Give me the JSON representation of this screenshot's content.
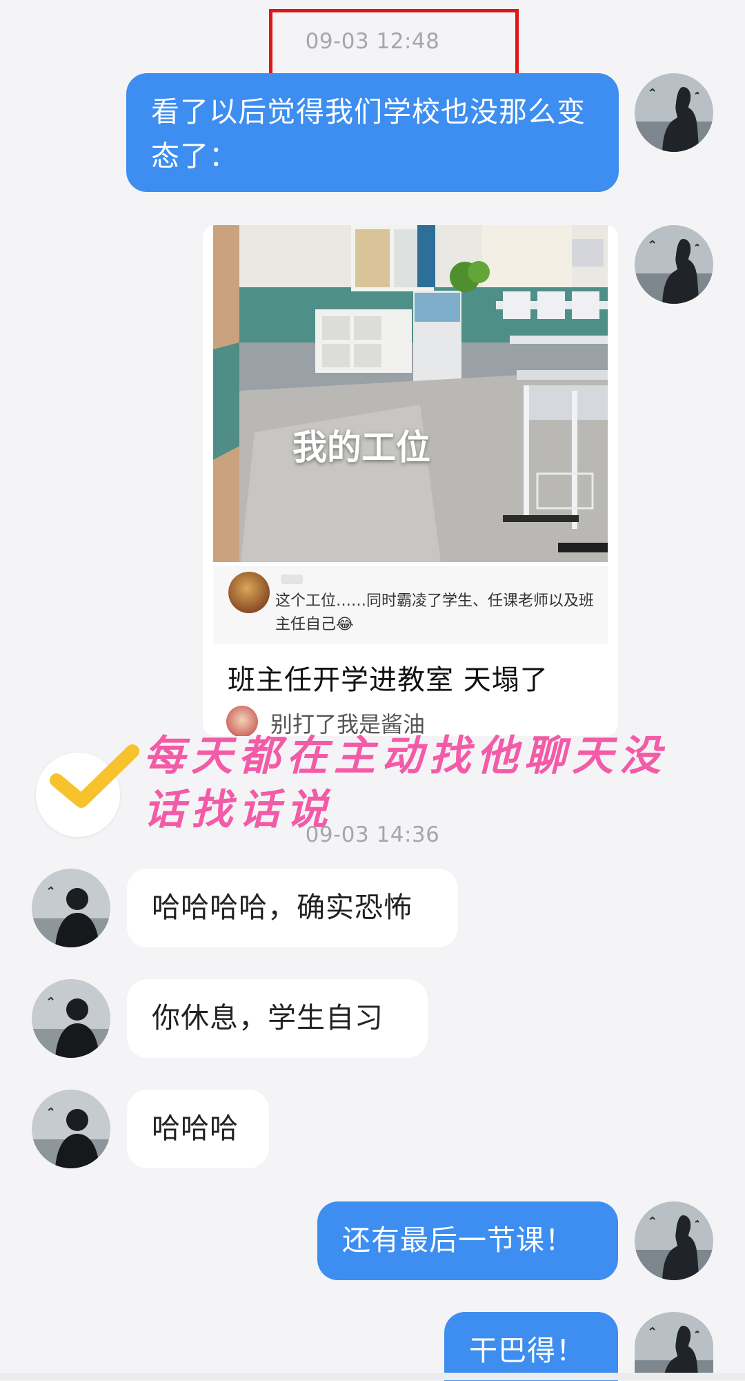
{
  "chat": {
    "timestamp_1": "09-03 12:48",
    "timestamp_2": "09-03 14:36",
    "msg_1": "看了以后觉得我们学校也没那么变态了：",
    "shared_post": {
      "image_caption": "我的工位",
      "comment": "这个工位……同时霸凌了学生、任课老师以及班主任自己😂",
      "title": "班主任开学进教室 天塌了",
      "author": "别打了我是酱油"
    },
    "msg_2": "哈哈哈哈，确实恐怖",
    "msg_3": "你休息，学生自习",
    "msg_4": "哈哈哈",
    "msg_5": "还有最后一节课！",
    "msg_6": "干巴得！"
  },
  "overlay": {
    "caption": "每天都在主动找他聊天没话找话说",
    "check_color": "#f7c22b",
    "text_color": "#f35ba7",
    "highlight_box_color": "#e01616"
  },
  "colors": {
    "outgoing_bubble": "#3d8ef0",
    "incoming_bubble": "#ffffff",
    "background": "#f4f4f6"
  }
}
